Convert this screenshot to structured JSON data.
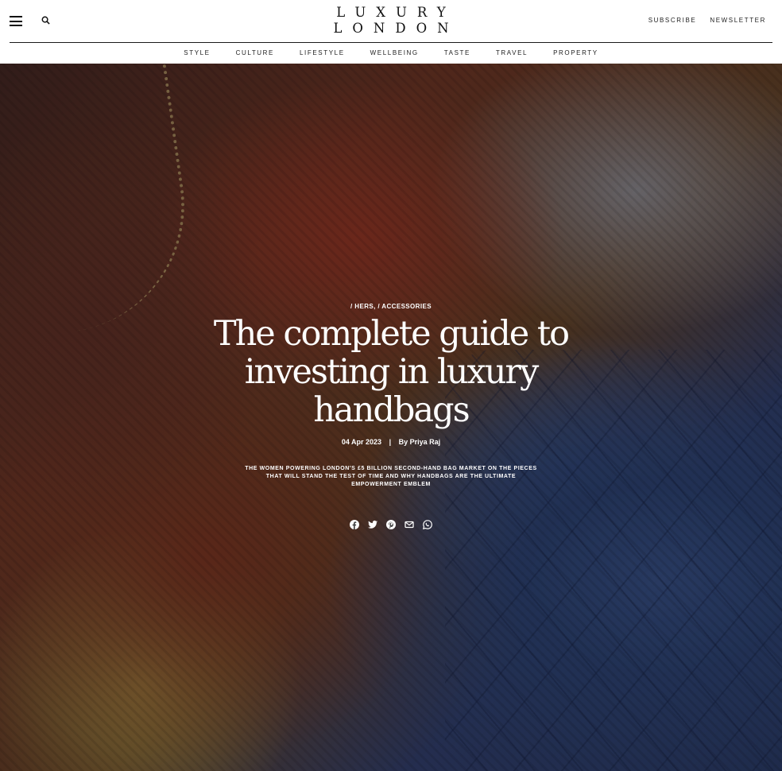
{
  "header": {
    "logo_line1": "LUXURY",
    "logo_line2": "LONDON",
    "subscribe_label": "SUBSCRIBE",
    "newsletter_label": "NEWSLETTER"
  },
  "nav": {
    "items": [
      "STYLE",
      "CULTURE",
      "LIFESTYLE",
      "WELLBEING",
      "TASTE",
      "TRAVEL",
      "PROPERTY"
    ]
  },
  "article": {
    "category_1": "/ HERS,",
    "category_2": "/ ACCESSORIES",
    "title": "The complete guide to investing in luxury handbags",
    "date": "04 Apr 2023",
    "separator": "|",
    "byline": "By Priya Raj",
    "standfirst": "THE WOMEN POWERING LONDON'S £5 BILLION SECOND-HAND BAG MARKET ON THE PIECES THAT WILL STAND THE TEST OF TIME AND WHY HANDBAGS ARE THE ULTIMATE EMPOWERMENT EMBLEM"
  },
  "share_icons": [
    "facebook-icon",
    "twitter-icon",
    "pinterest-icon",
    "email-icon",
    "whatsapp-icon"
  ],
  "colors": {
    "header_bg": "#ffffff",
    "text_dark": "#111111",
    "hero_text": "#ffffff",
    "bag_blue": "#34508c",
    "tweed_red": "#a63a26"
  }
}
